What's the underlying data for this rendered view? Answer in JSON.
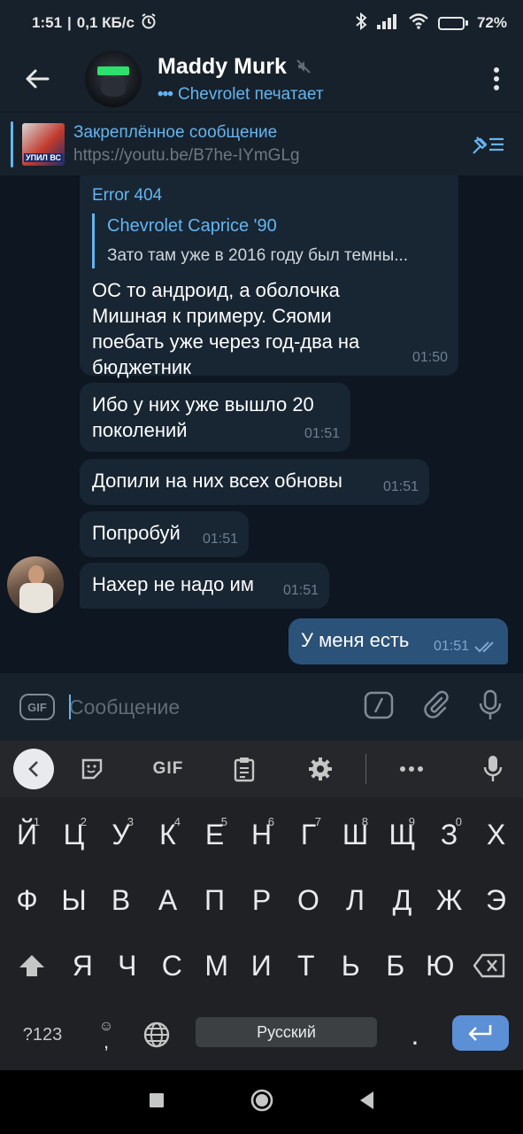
{
  "status_bar": {
    "time": "1:51",
    "network_speed": "0,1 КБ/с",
    "battery_percent": "72%",
    "battery_level": 0.72
  },
  "header": {
    "title": "Maddy Murk",
    "status": "Chevrolet печатает"
  },
  "pinned": {
    "title": "Закреплённое сообщение",
    "subtitle": "https://youtu.be/B7he-IYmGLg",
    "thumb_text": "УПИЛ ВС"
  },
  "messages": [
    {
      "sender": "Error 404",
      "reply_name": "Chevrolet Caprice '90",
      "reply_text": "Зато там уже в 2016 году был темны...",
      "text_lines": [
        "ОС то андроид, а оболочка",
        "Мишная к примеру. Сяоми",
        "поебать уже через год-два на",
        "бюджетник"
      ],
      "time": "01:50"
    },
    {
      "text_lines": [
        "Ибо у них уже вышло 20",
        "поколений"
      ],
      "time": "01:51"
    },
    {
      "text_lines": [
        "Допили на них всех обновы"
      ],
      "time": "01:51"
    },
    {
      "text_lines": [
        "Попробуй"
      ],
      "time": "01:51"
    },
    {
      "text_lines": [
        "Нахер не надо им"
      ],
      "time": "01:51"
    },
    {
      "text_lines": [
        "У меня есть"
      ],
      "time": "01:51",
      "outgoing": true
    }
  ],
  "input": {
    "gif_label": "GIF",
    "placeholder": "Сообщение"
  },
  "keyboard": {
    "toolbar_gif": "GIF",
    "row1": [
      {
        "k": "й",
        "h": "1"
      },
      {
        "k": "ц",
        "h": "2"
      },
      {
        "k": "у",
        "h": "3"
      },
      {
        "k": "к",
        "h": "4"
      },
      {
        "k": "е",
        "h": "5"
      },
      {
        "k": "н",
        "h": "6"
      },
      {
        "k": "г",
        "h": "7"
      },
      {
        "k": "ш",
        "h": "8"
      },
      {
        "k": "щ",
        "h": "9"
      },
      {
        "k": "з",
        "h": "0"
      },
      {
        "k": "х",
        "h": ""
      }
    ],
    "row2": [
      "ф",
      "ы",
      "в",
      "а",
      "п",
      "р",
      "о",
      "л",
      "д",
      "ж",
      "э"
    ],
    "row3": [
      "я",
      "ч",
      "с",
      "м",
      "и",
      "т",
      "ь",
      "б",
      "ю"
    ],
    "sym_key": "?123",
    "emoji_comma": ",",
    "space_label": "Русский",
    "period": "."
  },
  "colors": {
    "accent": "#64b5ef",
    "background": "#0e1621",
    "bubble_in": "#182533",
    "bubble_out": "#2b5278"
  }
}
